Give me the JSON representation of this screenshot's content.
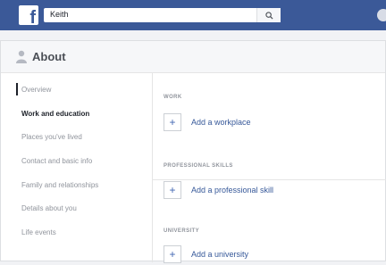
{
  "topbar": {
    "logo_letter": "f",
    "search": {
      "value": "Keith"
    }
  },
  "about": {
    "title": "About"
  },
  "nav": {
    "items": [
      {
        "label": "Overview"
      },
      {
        "label": "Work and education"
      },
      {
        "label": "Places you've lived"
      },
      {
        "label": "Contact and basic info"
      },
      {
        "label": "Family and relationships"
      },
      {
        "label": "Details about you"
      },
      {
        "label": "Life events"
      }
    ],
    "active_index": 1
  },
  "sections": [
    {
      "label": "WORK",
      "action": "Add a workplace"
    },
    {
      "label": "PROFESSIONAL SKILLS",
      "action": "Add a professional skill"
    },
    {
      "label": "UNIVERSITY",
      "action": "Add a university"
    }
  ],
  "colors": {
    "brand": "#3b5998",
    "link": "#365899"
  }
}
